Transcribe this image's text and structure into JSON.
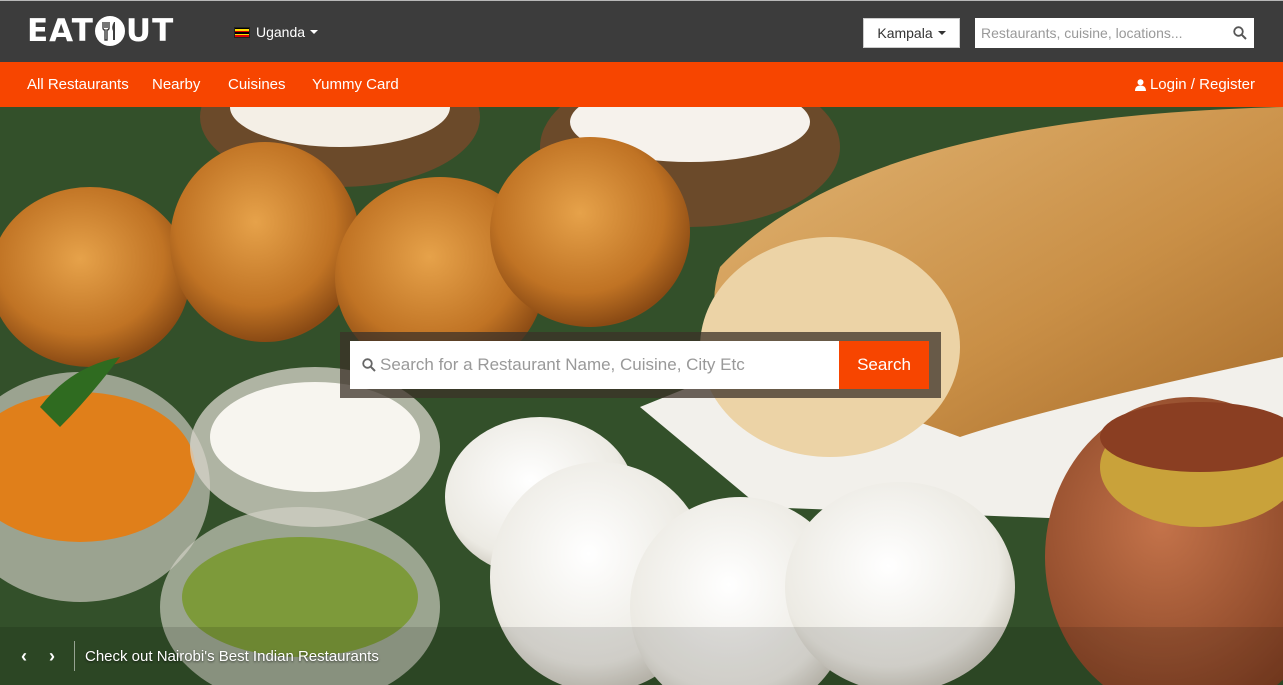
{
  "header": {
    "logo_text_left": "EAT",
    "logo_text_right": "UT",
    "logo_icon": "fork-knife-icon",
    "country": "Uganda",
    "flag_colors": [
      "#000000",
      "#fcdc04",
      "#d90000",
      "#000000",
      "#fcdc04",
      "#d90000"
    ],
    "city": "Kampala",
    "search_placeholder": "Restaurants, cuisine, locations..."
  },
  "nav": {
    "items": [
      "All Restaurants",
      "Nearby",
      "Cuisines",
      "Yummy Card"
    ],
    "login_label": "Login / Register"
  },
  "hero": {
    "search_placeholder": "Search for a Restaurant Name, Cuisine, City Etc",
    "search_button": "Search",
    "prev_label": "‹",
    "next_label": "›",
    "caption": "Check out Nairobi's Best Indian Restaurants"
  },
  "colors": {
    "topbar": "#3c3c3c",
    "accent": "#f74500"
  }
}
